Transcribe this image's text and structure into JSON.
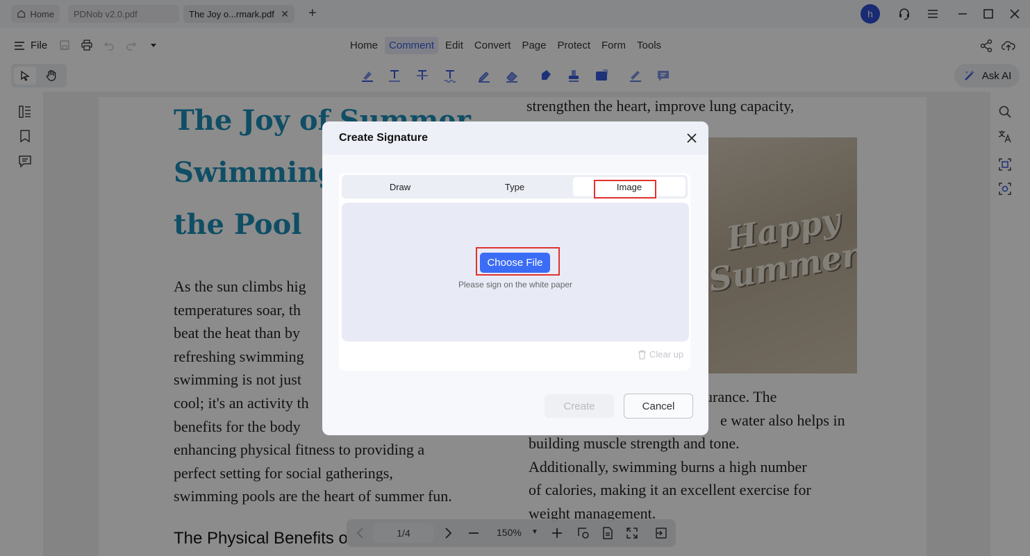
{
  "tabs": {
    "home": "Home",
    "pdnob": "PDNob v2.0.pdf",
    "active": "The Joy o...rmark.pdf",
    "avatar": "h"
  },
  "menubar": {
    "file_label": "File",
    "nav": [
      "Home",
      "Comment",
      "Edit",
      "Convert",
      "Page",
      "Protect",
      "Form",
      "Tools"
    ],
    "active_nav": "Comment"
  },
  "toolbar": {
    "ask_ai": "Ask AI"
  },
  "document": {
    "title_lines": [
      "The Joy of Summer",
      "Swimming",
      "the Pool"
    ],
    "left_paragraph_lines": [
      "As the sun climbs hig",
      "temperatures soar, th",
      "beat the heat than by",
      "refreshing swimming",
      "swimming is not just",
      "cool; it's an activity th",
      "benefits for the body",
      "enhancing physical fitness to providing a",
      "perfect setting for social gatherings,",
      "swimming pools are the heart of summer fun."
    ],
    "heading2": "The Physical Benefits o",
    "right_top_line": "strengthen the heart, improve lung capacity,",
    "image_text": [
      "Happy",
      "Summer"
    ],
    "right_paragraph_lines": [
      "urance. The",
      "e water also helps in",
      "building muscle strength and tone.",
      "Additionally, swimming burns a high number",
      "of calories, making it an excellent exercise for",
      "weight management."
    ]
  },
  "modal": {
    "title": "Create Signature",
    "tabs": [
      "Draw",
      "Type",
      "Image"
    ],
    "active_tab": "Image",
    "choose_file": "Choose File",
    "hint": "Please sign on the white paper",
    "clear_up": "Clear up",
    "create": "Create",
    "cancel": "Cancel"
  },
  "pagenav": {
    "page": "1/4",
    "zoom": "150%"
  },
  "colors": {
    "accent": "#3b6cf5",
    "title_blue": "#1d8fb9",
    "highlight_red": "#e0322e",
    "avatar_blue": "#2c4fd1"
  }
}
